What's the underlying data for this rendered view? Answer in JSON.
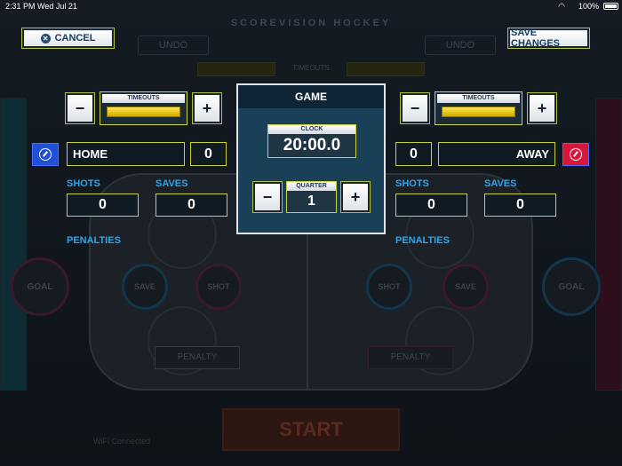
{
  "status_bar": {
    "time": "2:31 PM",
    "date": "Wed Jul 21",
    "battery": "100%"
  },
  "background": {
    "app_title": "SCOREVISION HOCKEY",
    "undo_label": "UNDO",
    "timeouts_label": "TIMEOUTS",
    "goal_label": "GOAL",
    "save_label": "SAVE",
    "shot_label": "SHOT",
    "penalty_label": "PENALTY",
    "start_label": "START",
    "footer_left": "WiFi Connected"
  },
  "toolbar": {
    "cancel_label": "CANCEL",
    "save_changes_label": "SAVE CHANGES"
  },
  "home": {
    "timeouts_label": "TIMEOUTS",
    "team_name": "HOME",
    "score": "0",
    "shots_label": "SHOTS",
    "shots": "0",
    "saves_label": "SAVES",
    "saves": "0",
    "penalties_label": "PENALTIES",
    "color": "#1e50d8",
    "minus": "−",
    "plus": "+"
  },
  "away": {
    "timeouts_label": "TIMEOUTS",
    "team_name": "AWAY",
    "score": "0",
    "shots_label": "SHOTS",
    "shots": "0",
    "saves_label": "SAVES",
    "saves": "0",
    "penalties_label": "PENALTIES",
    "color": "#d8163a",
    "minus": "−",
    "plus": "+"
  },
  "game": {
    "title": "GAME",
    "clock_label": "CLOCK",
    "clock": "20:00.0",
    "quarter_label": "QUARTER",
    "quarter": "1",
    "minus": "−",
    "plus": "+"
  }
}
